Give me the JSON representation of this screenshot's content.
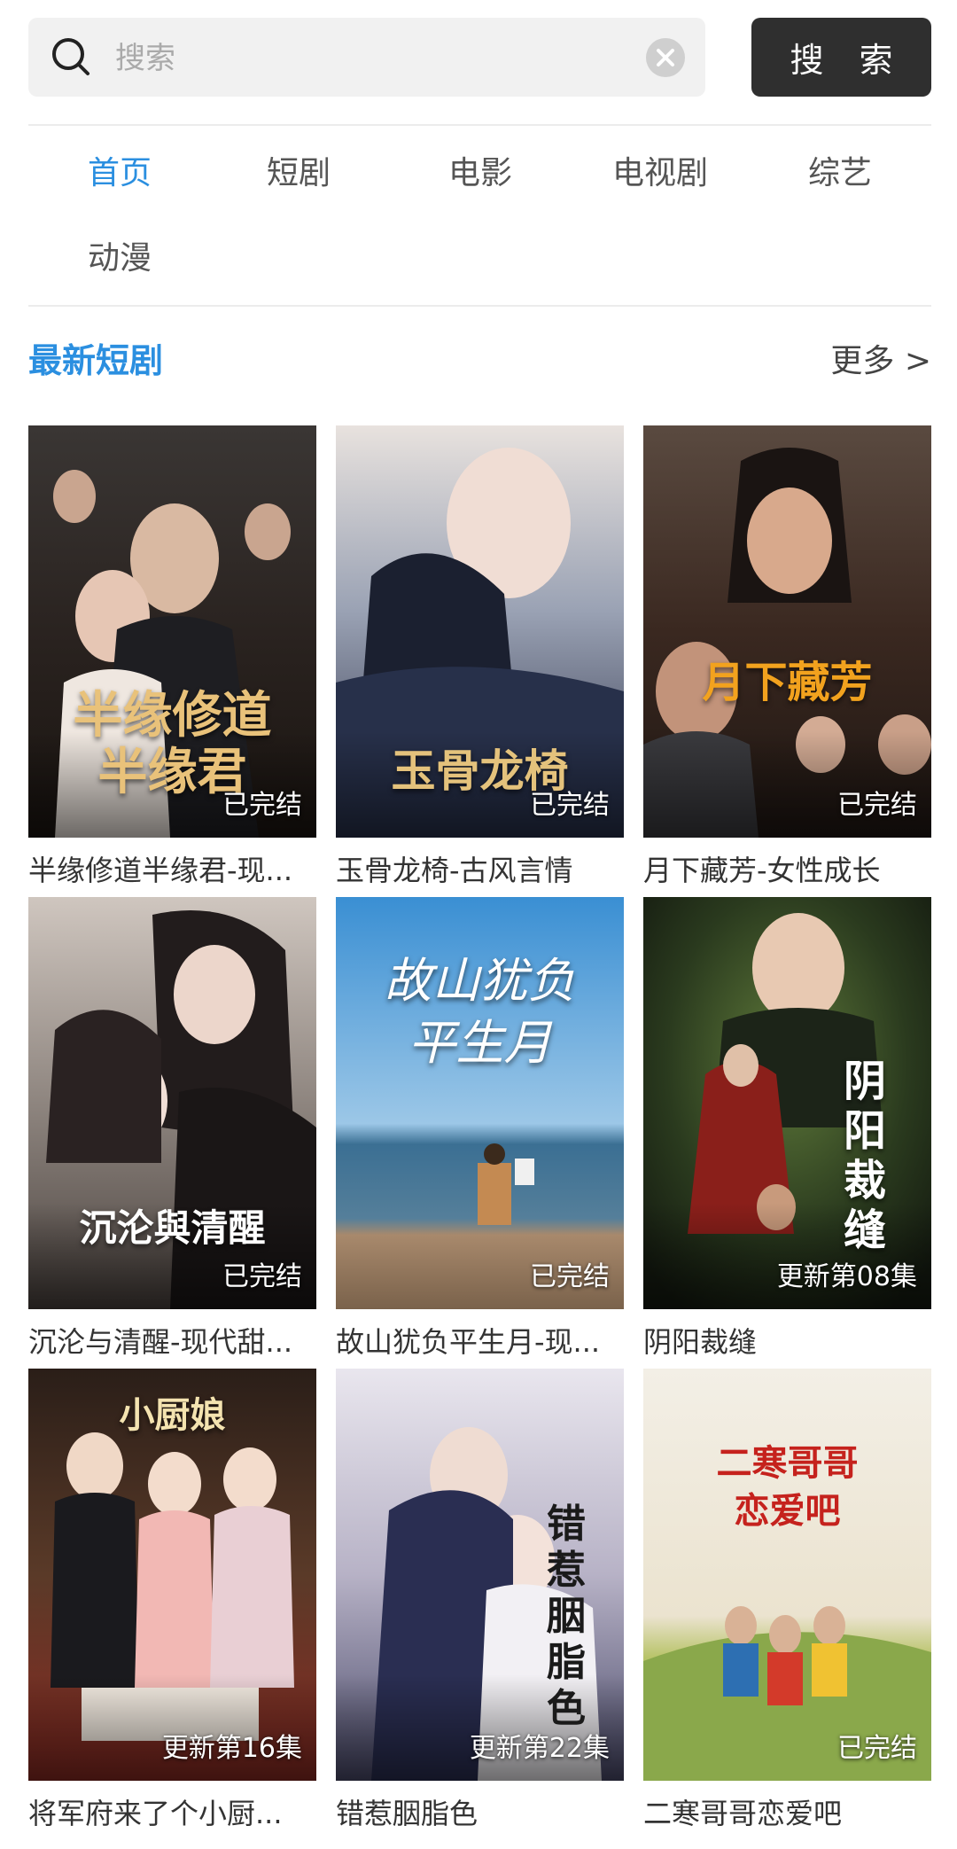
{
  "search": {
    "placeholder": "搜索",
    "button_label": "搜 索"
  },
  "tabs": [
    {
      "label": "首页",
      "active": true
    },
    {
      "label": "短剧"
    },
    {
      "label": "电影"
    },
    {
      "label": "电视剧"
    },
    {
      "label": "综艺"
    },
    {
      "label": "动漫"
    }
  ],
  "section": {
    "title": "最新短剧",
    "more_label": "更多 >"
  },
  "colors": {
    "accent": "#2b8fe0",
    "button_bg": "#2f2f2f"
  },
  "items": [
    {
      "title": "半缘修道半缘君-现...",
      "poster_text": "半缘修道\n半缘君",
      "status": "已完结"
    },
    {
      "title": "玉骨龙椅-古风言情",
      "poster_text": "玉骨龙椅",
      "status": "已完结"
    },
    {
      "title": "月下藏芳-女性成长",
      "poster_text": "月下藏芳",
      "status": "已完结"
    },
    {
      "title": "沉沦与清醒-现代甜...",
      "poster_text": "沉沦與清醒",
      "status": "已完结"
    },
    {
      "title": "故山犹负平生月-现...",
      "poster_text": "故山犹负\n平生月",
      "status": "已完结"
    },
    {
      "title": "阴阳裁缝",
      "poster_text": "阴阳裁缝",
      "status": "更新第08集"
    },
    {
      "title": "将军府来了个小厨...",
      "poster_text": "小厨娘",
      "status": "更新第16集"
    },
    {
      "title": "错惹胭脂色",
      "poster_text": "错惹胭脂色",
      "status": "更新第22集"
    },
    {
      "title": "二寒哥哥恋爱吧",
      "poster_text": "二寒哥哥\n恋爱吧",
      "status": "已完结"
    }
  ]
}
